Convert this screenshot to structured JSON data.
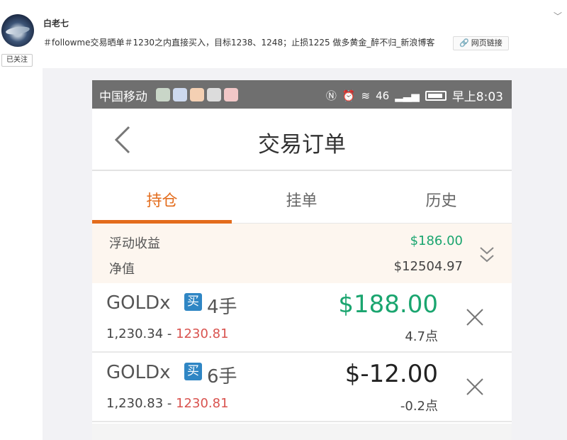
{
  "post": {
    "username": "白老七",
    "follow_label": "已关注",
    "text": "＃followme交易晒单＃1230之内直接买入，目标1238、1248；止损1225 做多黄金_醉不归_新浪博客",
    "link_label": "网页链接",
    "link_icon": "link-icon",
    "menu_icon": "chevron-down-icon"
  },
  "phone": {
    "status_bar": {
      "carrier": "中国移动",
      "network": "46",
      "time": "早上8:03"
    },
    "nav": {
      "title": "交易订单",
      "back_icon": "chevron-left-icon"
    },
    "tabs": [
      {
        "label": "持仓",
        "active": true
      },
      {
        "label": "挂单",
        "active": false
      },
      {
        "label": "历史",
        "active": false
      }
    ],
    "summary": {
      "floating_pnl_label": "浮动收益",
      "floating_pnl_value": "$186.00",
      "equity_label": "净值",
      "equity_value": "$12504.97"
    },
    "positions": [
      {
        "symbol": "GOLDx",
        "side": "买",
        "lots": "4手",
        "open_price": "1,230.34",
        "separator": " - ",
        "current_price": "1230.81",
        "pnl": "$188.00",
        "points": "4.7点"
      },
      {
        "symbol": "GOLDx",
        "side": "买",
        "lots": "6手",
        "open_price": "1,230.83",
        "separator": " - ",
        "current_price": "1230.81",
        "pnl": "$-12.00",
        "points": "-0.2点"
      }
    ]
  },
  "colors": {
    "accent_orange": "#e36c1c",
    "profit_green": "#1aa56f",
    "price_red": "#d9534f",
    "buy_badge_blue": "#2f86c4"
  }
}
